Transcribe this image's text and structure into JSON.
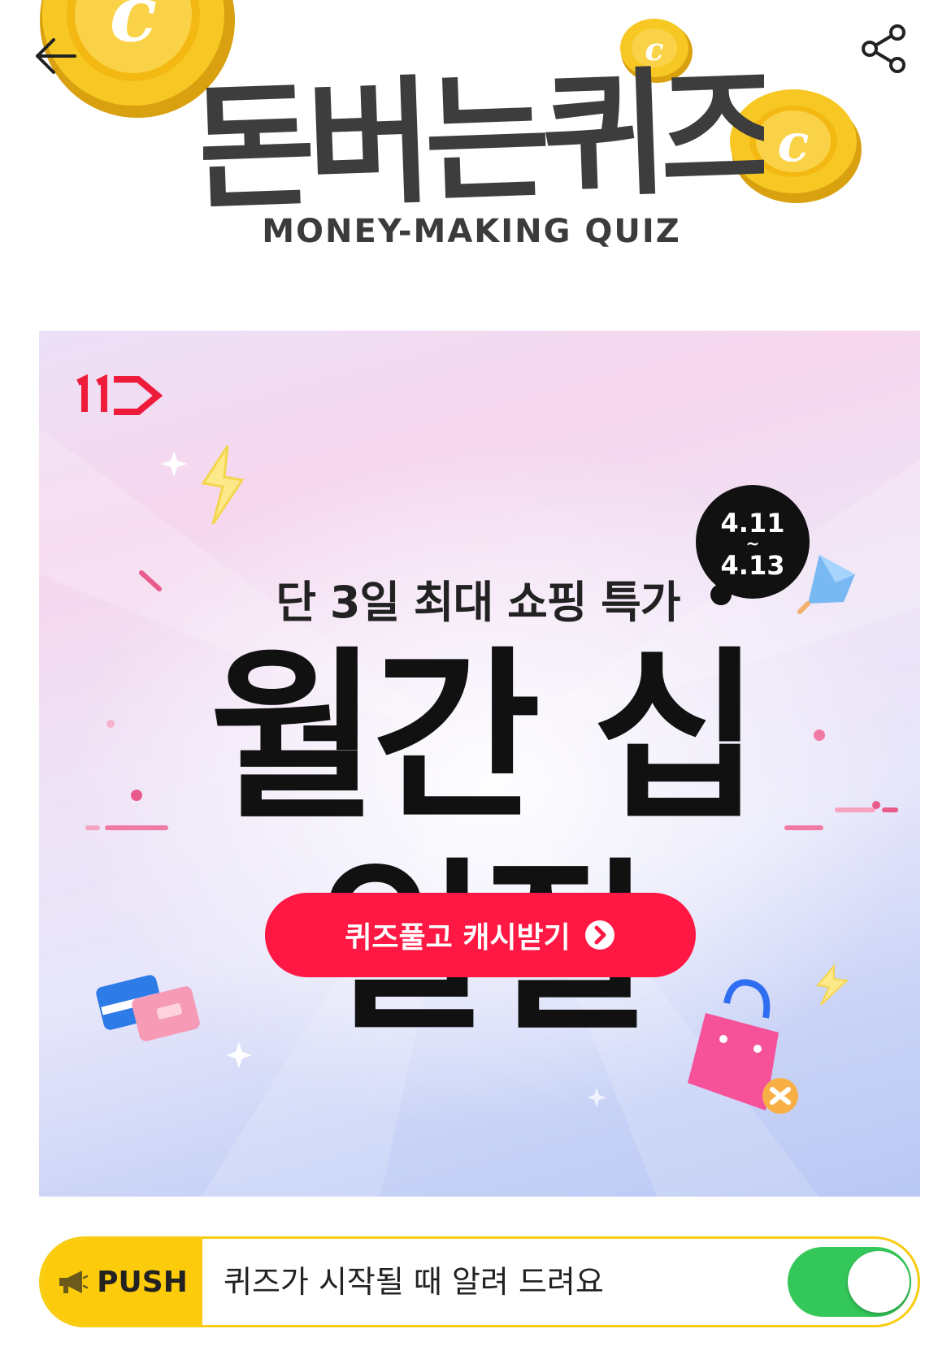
{
  "header": {
    "back_icon": "arrow-left-icon",
    "share_icon": "share-icon",
    "title": "돈버는퀴즈",
    "subtitle": "MONEY-MAKING QUIZ",
    "coin_letter": "c"
  },
  "banner": {
    "brand_logo": "11번가 logo",
    "subtitle": "단 3일 최대 쇼핑 특가",
    "date_start": "4.11",
    "date_sep": "~",
    "date_end": "4.13",
    "title": "월간 십일절",
    "cta_label": "퀴즈풀고 캐시받기",
    "cta_icon": "chevron-right-circle-icon"
  },
  "push": {
    "icon": "megaphone-icon",
    "tag_label": "PUSH",
    "text": "퀴즈가 시작될 때 알려 드려요",
    "toggle_on": true
  },
  "colors": {
    "accent_red": "#ff1843",
    "push_yellow": "#fccc0c",
    "toggle_green": "#34c759",
    "coin_gold": "#f5c21b"
  }
}
